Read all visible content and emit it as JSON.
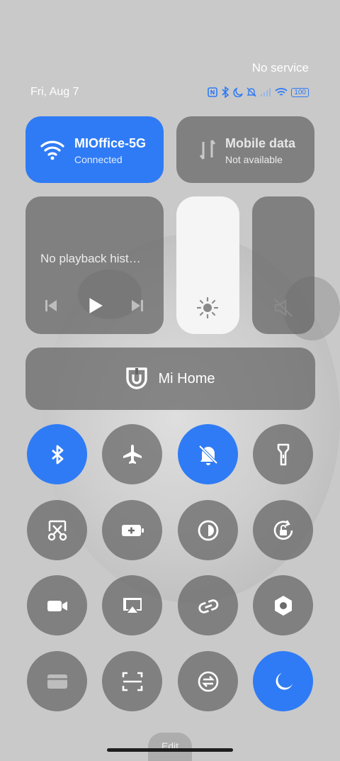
{
  "status": {
    "carrier": "No service",
    "date": "Fri, Aug 7",
    "battery": "100",
    "icons": [
      "nfc-icon",
      "bluetooth-icon",
      "moon-icon",
      "silent-icon",
      "signal-icon",
      "wifi-icon",
      "battery-icon"
    ]
  },
  "wifi": {
    "title": "MIOffice-5G",
    "subtitle": "Connected",
    "active": true
  },
  "mobile_data": {
    "title": "Mobile data",
    "subtitle": "Not available",
    "active": false
  },
  "media": {
    "title": "No playback hist…"
  },
  "mi_home": {
    "label": "Mi Home"
  },
  "toggles": [
    {
      "name": "bluetooth-toggle",
      "icon": "bluetooth-icon",
      "active": true
    },
    {
      "name": "airplane-toggle",
      "icon": "airplane-icon",
      "active": false
    },
    {
      "name": "silent-toggle",
      "icon": "silent-bell-icon",
      "active": true
    },
    {
      "name": "flashlight-toggle",
      "icon": "flashlight-icon",
      "active": false
    },
    {
      "name": "screenshot-toggle",
      "icon": "scissors-icon",
      "active": false
    },
    {
      "name": "battery-saver-toggle",
      "icon": "battery-plus-icon",
      "active": false
    },
    {
      "name": "dark-mode-toggle",
      "icon": "contrast-icon",
      "active": false
    },
    {
      "name": "rotation-lock-toggle",
      "icon": "rotation-lock-icon",
      "active": false
    },
    {
      "name": "screen-recorder-toggle",
      "icon": "video-icon",
      "active": false
    },
    {
      "name": "cast-toggle",
      "icon": "cast-icon",
      "active": false
    },
    {
      "name": "link-toggle",
      "icon": "link-icon",
      "active": false
    },
    {
      "name": "settings-toggle",
      "icon": "hex-settings-icon",
      "active": false
    },
    {
      "name": "card-toggle",
      "icon": "card-icon",
      "active": false
    },
    {
      "name": "scanner-toggle",
      "icon": "scan-icon",
      "active": false
    },
    {
      "name": "sync-toggle",
      "icon": "sync-icon",
      "active": false
    },
    {
      "name": "dnd-toggle",
      "icon": "moon-icon",
      "active": true
    }
  ],
  "edit_label": "Edit",
  "colors": {
    "accent": "#2f7bf5",
    "tile_gray": "#646464"
  }
}
